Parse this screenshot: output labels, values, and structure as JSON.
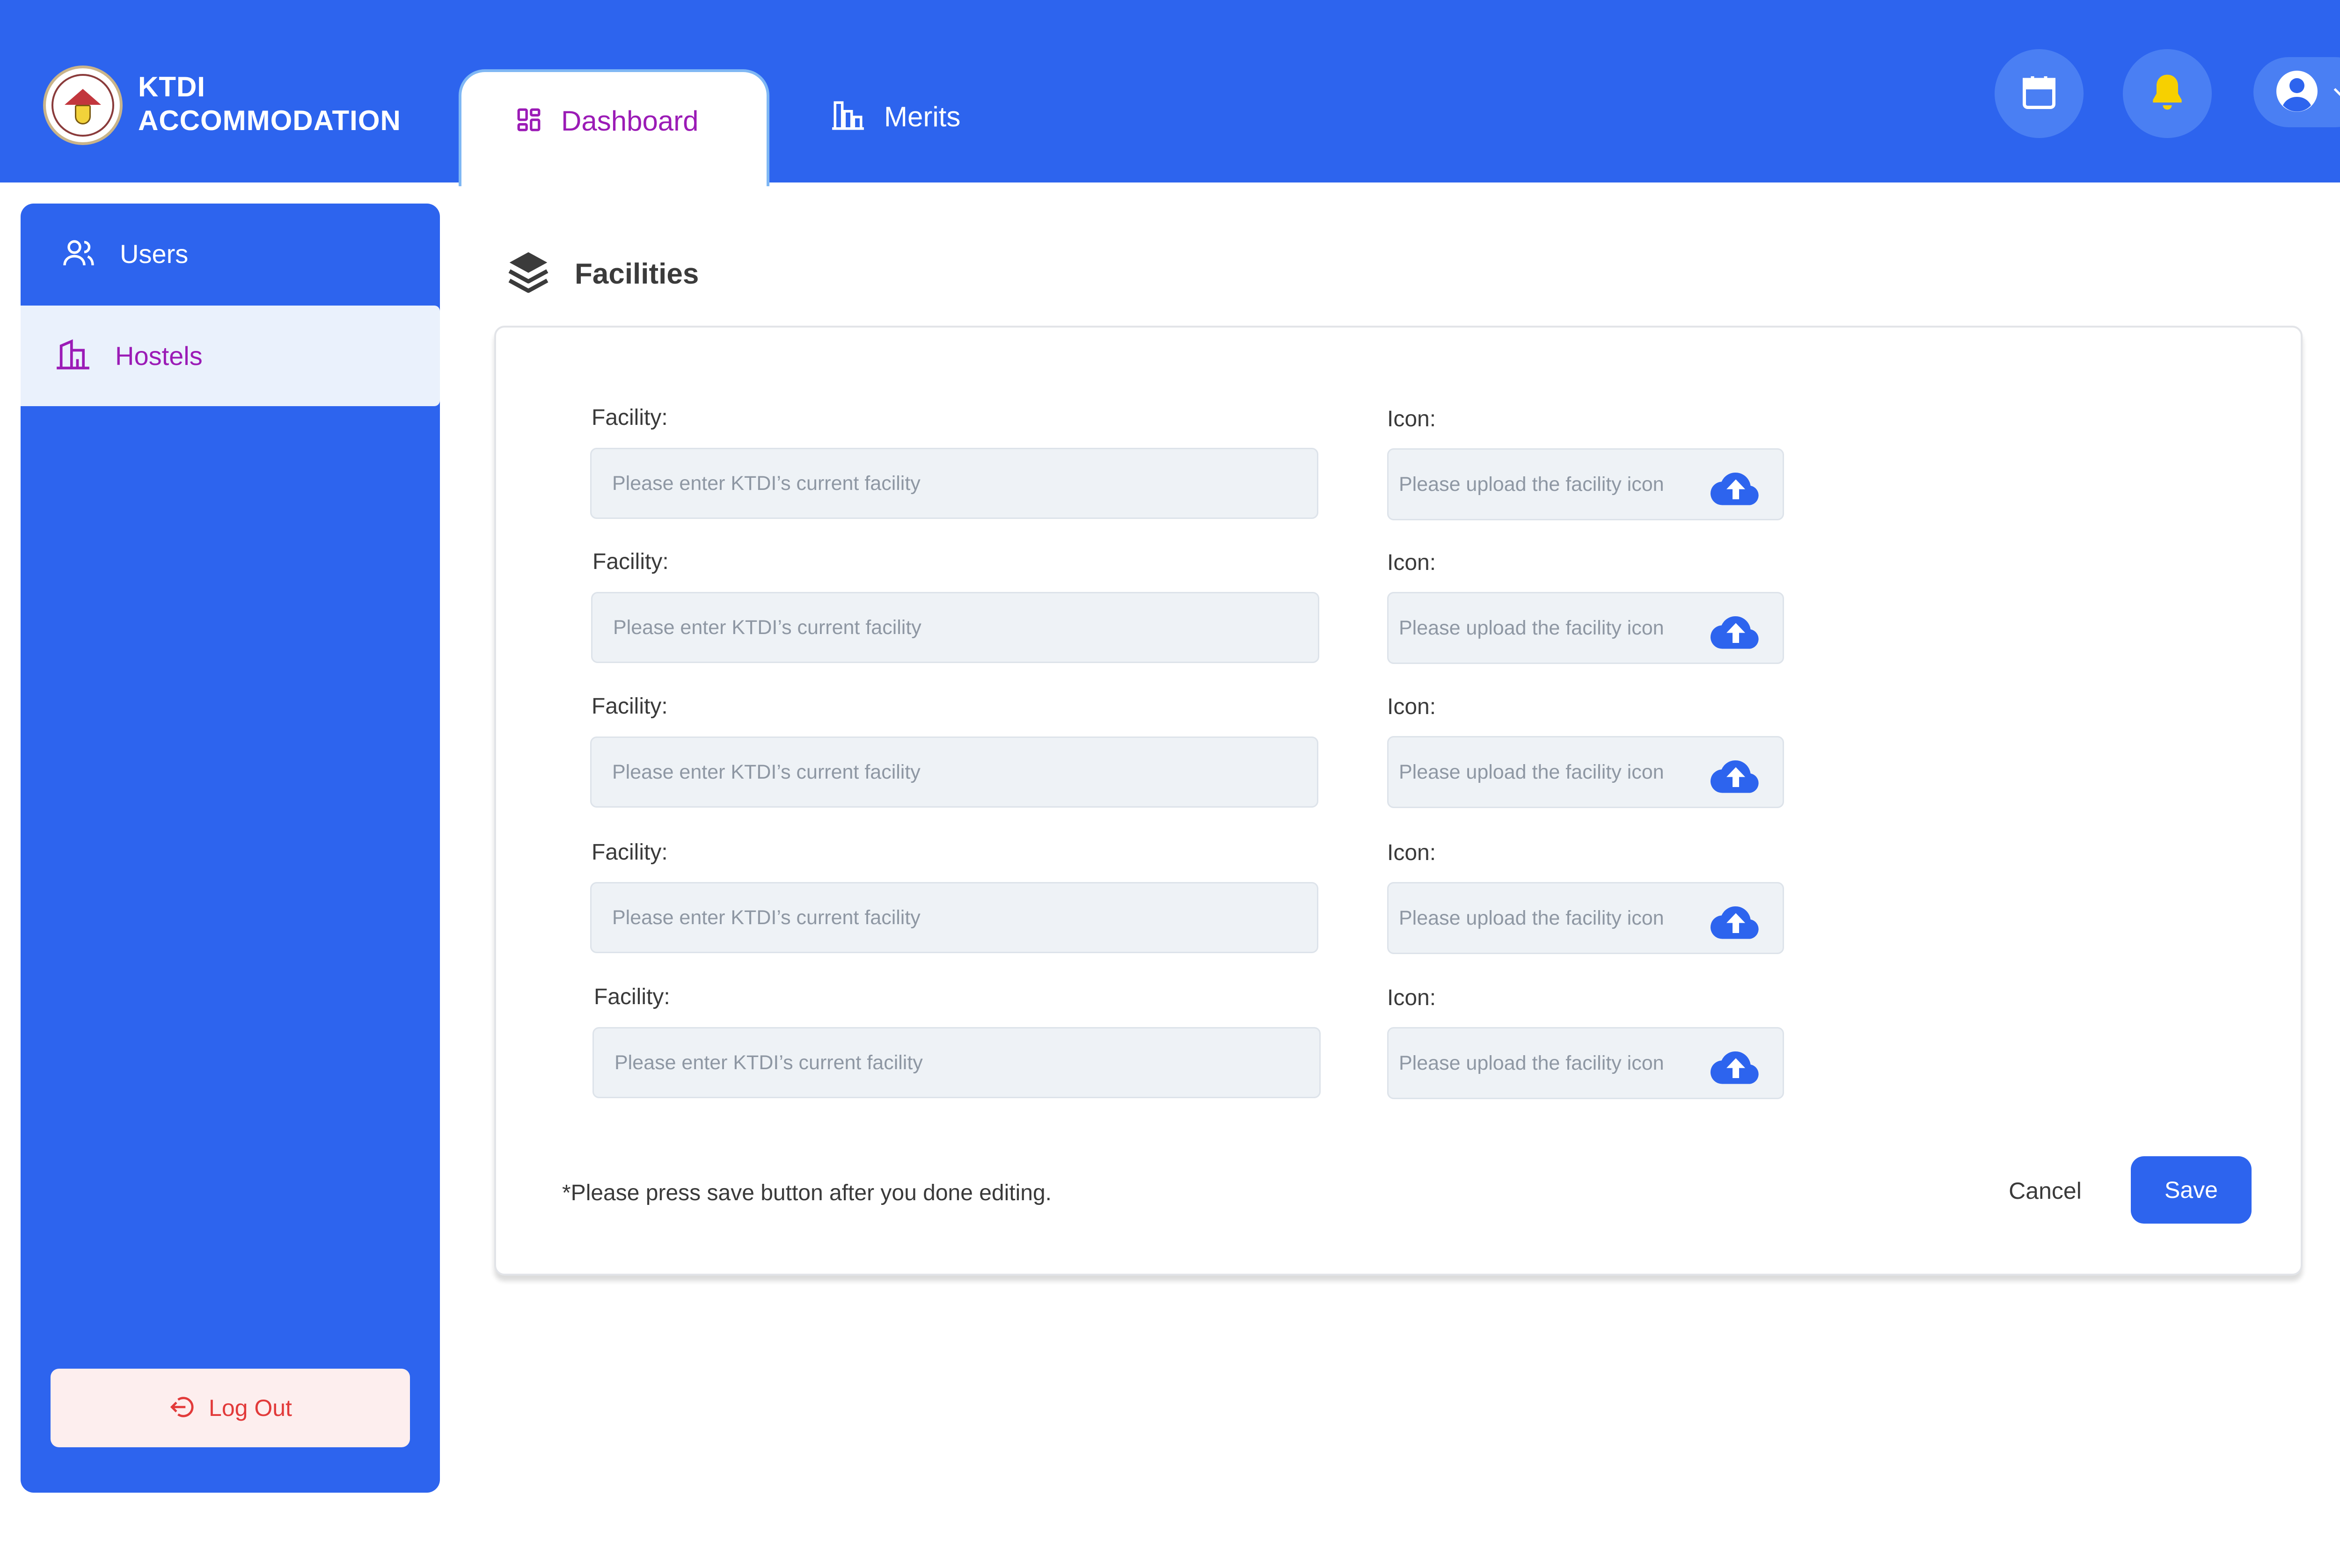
{
  "app": {
    "brand_line1": "KTDI",
    "brand_line2": "ACCOMMODATION"
  },
  "nav": {
    "tabs": [
      {
        "label": "Dashboard",
        "icon": "dashboard-grid-icon",
        "active": true
      },
      {
        "label": "Merits",
        "icon": "bar-chart-icon",
        "active": false
      }
    ],
    "actions": [
      {
        "icon": "calendar-icon"
      },
      {
        "icon": "bell-icon"
      },
      {
        "icon": "user-avatar-icon"
      }
    ]
  },
  "sidebar": {
    "items": [
      {
        "label": "Users",
        "icon": "users-icon",
        "active": false
      },
      {
        "label": "Hostels",
        "icon": "building-icon",
        "active": true
      }
    ],
    "logout_label": "Log Out"
  },
  "main": {
    "section_title": "Facilities",
    "section_icon": "layers-icon",
    "rows": [
      {
        "facility_label": "Facility:",
        "facility_placeholder": "Please enter KTDI’s current facility",
        "icon_label": "Icon:",
        "icon_placeholder": "Please upload the facility icon"
      },
      {
        "facility_label": "Facility:",
        "facility_placeholder": "Please enter KTDI’s current facility",
        "icon_label": "Icon:",
        "icon_placeholder": "Please upload the facility icon"
      },
      {
        "facility_label": "Facility:",
        "facility_placeholder": "Please enter KTDI’s current facility",
        "icon_label": "Icon:",
        "icon_placeholder": "Please upload the facility icon"
      },
      {
        "facility_label": "Facility:",
        "facility_placeholder": "Please enter KTDI’s current facility",
        "icon_label": "Icon:",
        "icon_placeholder": "Please upload the facility icon"
      },
      {
        "facility_label": "Facility:",
        "facility_placeholder": "Please enter KTDI’s current facility",
        "icon_label": "Icon:",
        "icon_placeholder": "Please upload the facility icon"
      }
    ],
    "note": "*Please press save button after you done editing.",
    "cancel_label": "Cancel",
    "save_label": "Save"
  },
  "colors": {
    "primary": "#2d64ee",
    "active_text": "#9b1bb6",
    "bell": "#f7d000",
    "logout_text": "#e23a3a"
  }
}
